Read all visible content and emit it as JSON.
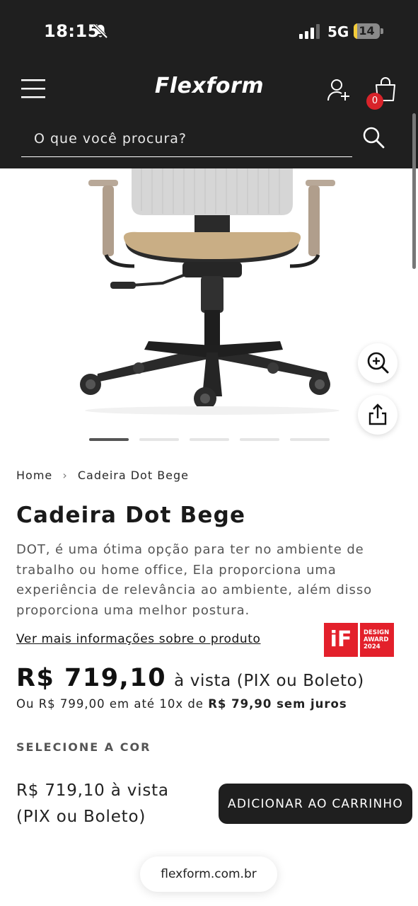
{
  "status_bar": {
    "time": "18:15",
    "network": "5G",
    "battery": "14",
    "battery_level": 0.14
  },
  "header": {
    "logo": "Flexform",
    "cart_count": "0",
    "search_placeholder": "O que você procura?"
  },
  "product": {
    "breadcrumb": [
      "Home",
      "Cadeira Dot Bege"
    ],
    "title": "Cadeira Dot Bege",
    "description": "DOT, é uma ótima opção para ter no ambiente de trabalho ou home office, Ela proporciona uma experiência de relevância ao ambiente, além disso proporciona uma melhor postura.",
    "more_info_link": "Ver mais informações sobre o produto",
    "award": {
      "logo": "iF",
      "line1": "DESIGN",
      "line2": "AWARD",
      "line3": "2024"
    },
    "price": "R$ 719,10",
    "price_note": "à vista (PIX ou Boleto)",
    "installments_prefix": "Ou R$ 799,00 em até 10x de",
    "installments_value": "R$ 79,90 sem juros",
    "color_label": "SELECIONE A COR",
    "image_count": 5,
    "active_image": 1
  },
  "bottom_bar": {
    "price_line1": "R$ 719,10 à vista",
    "price_line2": "(PIX ou Boleto)",
    "add_to_cart": "ADICIONAR AO CARRINHO"
  },
  "browser": {
    "url": "flexform.com.br"
  },
  "colors": {
    "header_bg": "#1f1f1f",
    "badge_red": "#d8232a",
    "award_red": "#e3202b",
    "seat_beige": "#c9ae85"
  }
}
